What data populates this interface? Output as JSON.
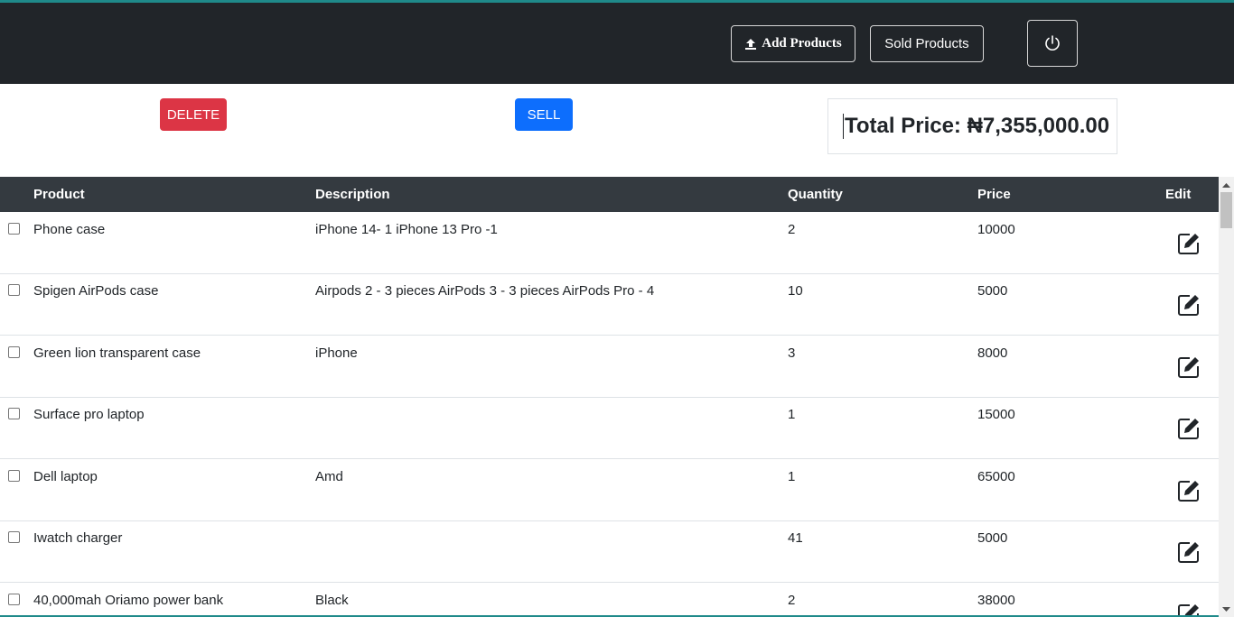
{
  "navbar": {
    "add_products_label": "Add Products",
    "sold_products_label": "Sold Products",
    "power_icon": "power-icon",
    "upload_icon": "upload-icon"
  },
  "actions": {
    "delete_label": "DELETE",
    "sell_label": "SELL"
  },
  "total": {
    "text": "Total Price: ₦7,355,000.00"
  },
  "table": {
    "headers": {
      "product": "Product",
      "description": "Description",
      "quantity": "Quantity",
      "price": "Price",
      "edit": "Edit"
    },
    "rows": [
      {
        "product": "Phone case",
        "description": "iPhone 14- 1 iPhone 13 Pro -1",
        "quantity": "2",
        "price": "10000"
      },
      {
        "product": "Spigen AirPods case",
        "description": "Airpods 2 - 3 pieces AirPods 3 - 3 pieces AirPods Pro - 4",
        "quantity": "10",
        "price": "5000"
      },
      {
        "product": "Green lion transparent case",
        "description": "iPhone",
        "quantity": "3",
        "price": "8000"
      },
      {
        "product": "Surface pro laptop",
        "description": "",
        "quantity": "1",
        "price": "15000"
      },
      {
        "product": "Dell laptop",
        "description": "Amd",
        "quantity": "1",
        "price": "65000"
      },
      {
        "product": "Iwatch charger",
        "description": "",
        "quantity": "41",
        "price": "5000"
      },
      {
        "product": "40,000mah Oriamo power bank",
        "description": "Black",
        "quantity": "2",
        "price": "38000"
      }
    ]
  },
  "colors": {
    "navbar_bg": "#212529",
    "table_header_bg": "#343a40",
    "delete_bg": "#dc3545",
    "sell_bg": "#0d6efd",
    "accent_line": "#1f8a8a"
  }
}
